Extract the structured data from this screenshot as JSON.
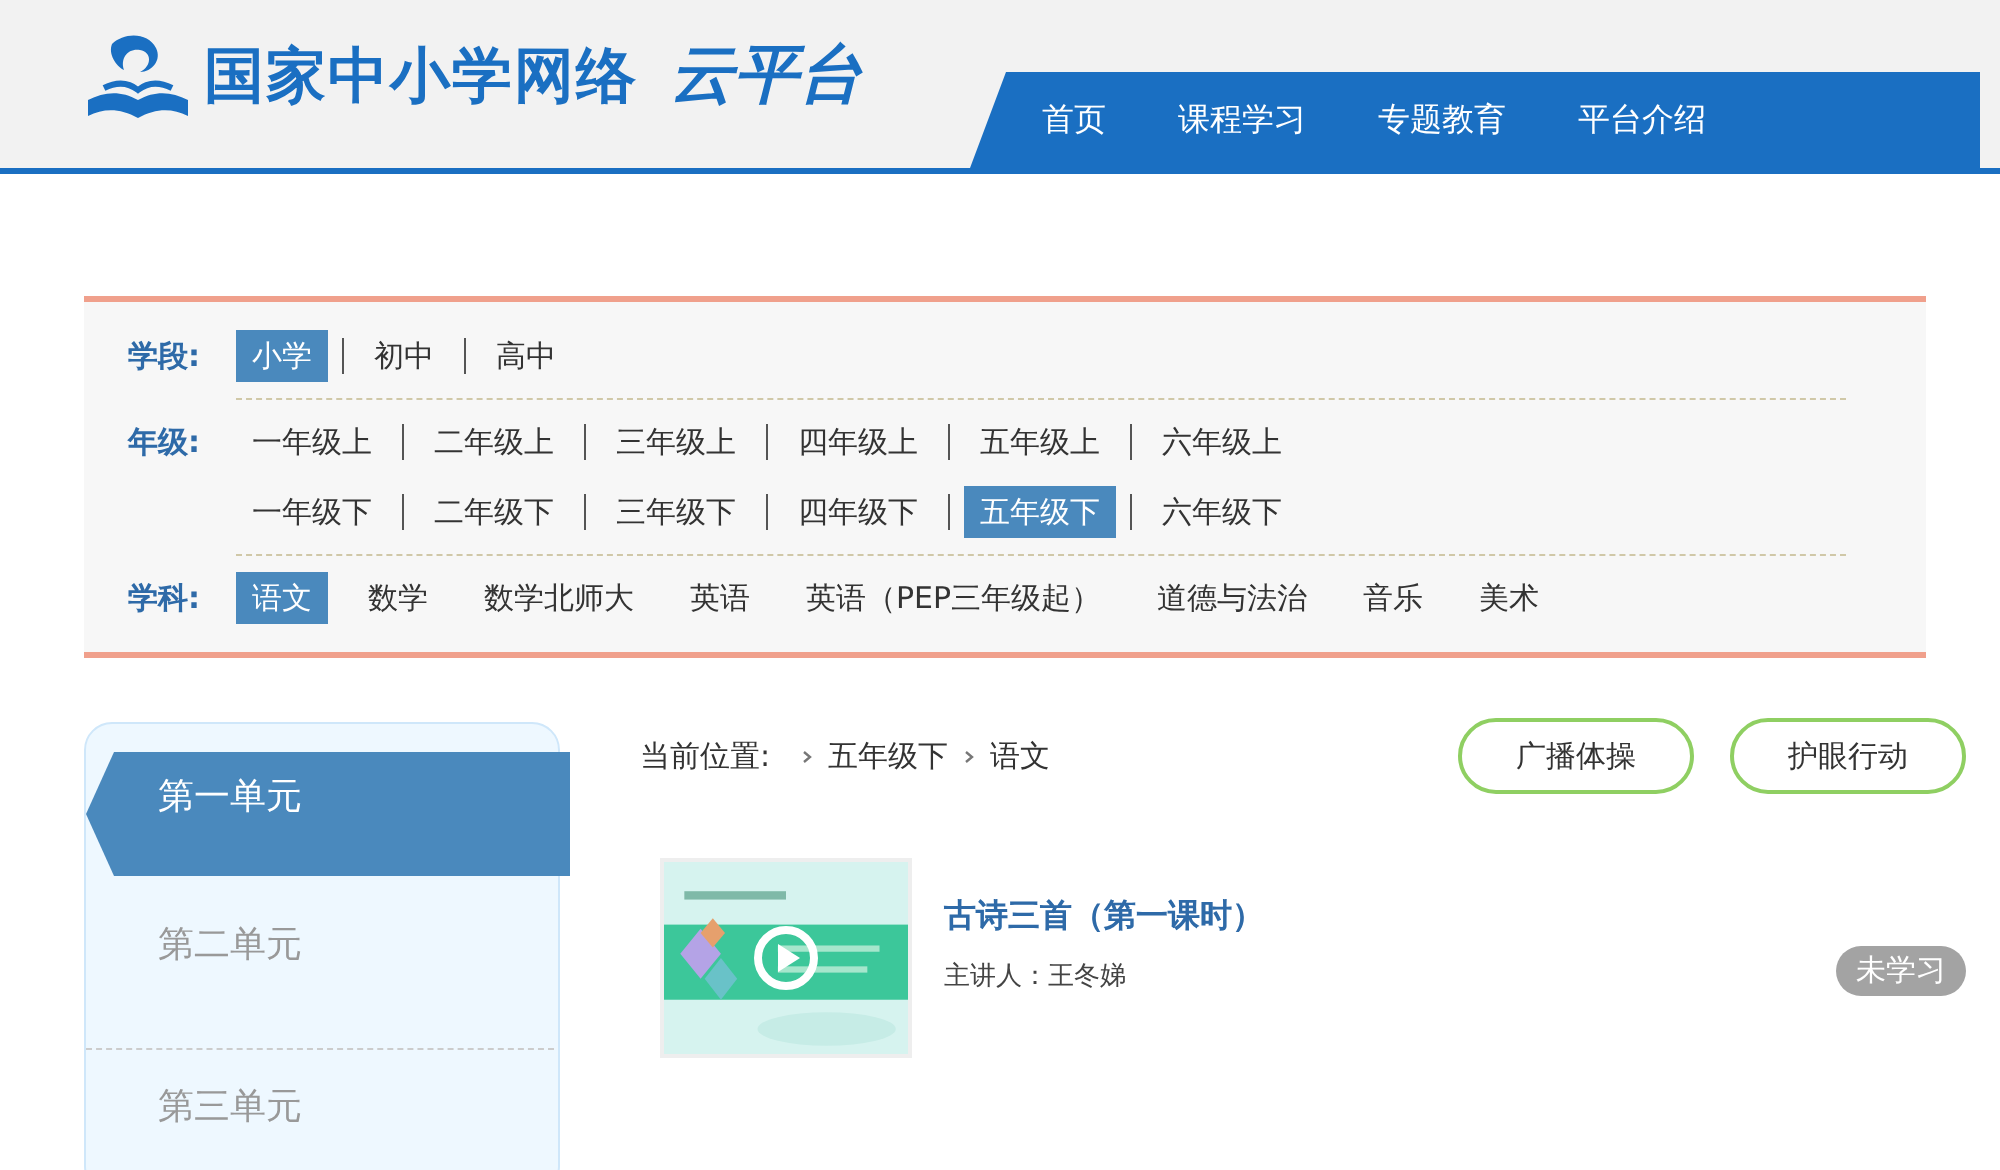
{
  "header": {
    "logo_text": "国家中小学网络",
    "logo_brand": "云平台",
    "nav": [
      {
        "label": "首页",
        "selected": false
      },
      {
        "label": "课程学习",
        "selected": false
      },
      {
        "label": "专题教育",
        "selected": false
      },
      {
        "label": "平台介绍",
        "selected": false
      }
    ]
  },
  "filters": [
    {
      "label": "学段:",
      "dividers": true,
      "lines": [
        [
          {
            "text": "小学",
            "selected": true
          },
          {
            "text": "初中",
            "selected": false
          },
          {
            "text": "高中",
            "selected": false
          }
        ]
      ]
    },
    {
      "label": "年级:",
      "dividers": true,
      "lines": [
        [
          {
            "text": "一年级上",
            "selected": false
          },
          {
            "text": "二年级上",
            "selected": false
          },
          {
            "text": "三年级上",
            "selected": false
          },
          {
            "text": "四年级上",
            "selected": false
          },
          {
            "text": "五年级上",
            "selected": false
          },
          {
            "text": "六年级上",
            "selected": false
          }
        ],
        [
          {
            "text": "一年级下",
            "selected": false
          },
          {
            "text": "二年级下",
            "selected": false
          },
          {
            "text": "三年级下",
            "selected": false
          },
          {
            "text": "四年级下",
            "selected": false
          },
          {
            "text": "五年级下",
            "selected": true
          },
          {
            "text": "六年级下",
            "selected": false
          }
        ]
      ]
    },
    {
      "label": "学科:",
      "dividers": false,
      "lines": [
        [
          {
            "text": "语文",
            "selected": true
          },
          {
            "text": "数学",
            "selected": false
          },
          {
            "text": "数学北师大",
            "selected": false
          },
          {
            "text": "英语",
            "selected": false
          },
          {
            "text": "英语（PEP三年级起）",
            "selected": false
          },
          {
            "text": "道德与法治",
            "selected": false
          },
          {
            "text": "音乐",
            "selected": false
          },
          {
            "text": "美术",
            "selected": false
          }
        ]
      ]
    }
  ],
  "units": [
    {
      "label": "第一单元",
      "selected": true
    },
    {
      "label": "第二单元",
      "selected": false
    },
    {
      "label": "第三单元",
      "selected": false
    }
  ],
  "breadcrumb": {
    "label": "当前位置:",
    "items": [
      "五年级下",
      "语文"
    ]
  },
  "actions": [
    "广播体操",
    "护眼行动"
  ],
  "lessons": [
    {
      "kind": "picture",
      "title": "古诗三首（第一课时）",
      "teacher": "主讲人：王冬娣",
      "status": "未学习"
    }
  ]
}
